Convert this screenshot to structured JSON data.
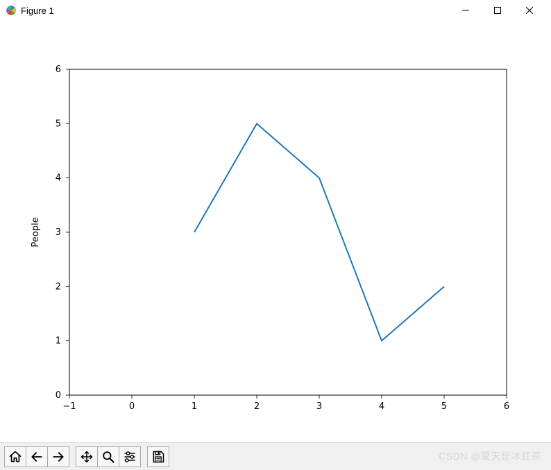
{
  "window": {
    "title": "Figure 1"
  },
  "toolbar": {
    "home_name": "home-button",
    "back_name": "back-button",
    "forward_name": "forward-button",
    "pan_name": "pan-button",
    "zoom_name": "zoom-button",
    "configure_name": "configure-subplots-button",
    "save_name": "save-button"
  },
  "watermark": "CSDN @夏天是冰红茶",
  "chart_data": {
    "type": "line",
    "x": [
      1,
      2,
      3,
      4,
      5
    ],
    "y": [
      3,
      5,
      4,
      1,
      2
    ],
    "xlabel": "",
    "ylabel": "People",
    "xlim": [
      -1,
      6
    ],
    "ylim": [
      0,
      6
    ],
    "xticks": [
      -1,
      0,
      1,
      2,
      3,
      4,
      5,
      6
    ],
    "yticks": [
      0,
      1,
      2,
      3,
      4,
      5,
      6
    ],
    "line_color": "#1f77b4",
    "grid": false
  }
}
